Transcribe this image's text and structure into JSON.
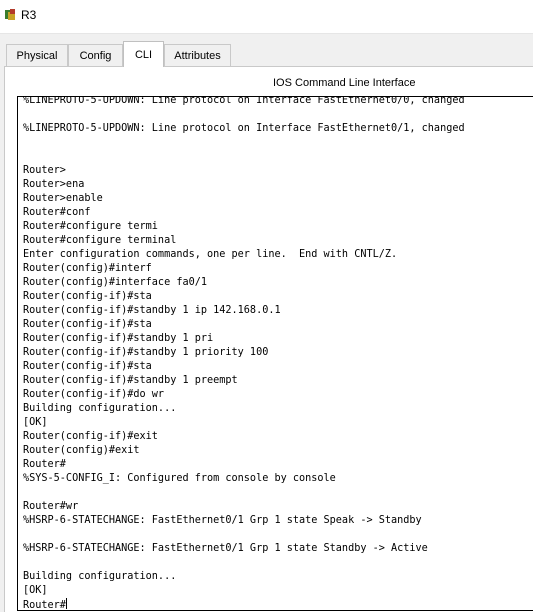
{
  "window": {
    "title": "R3"
  },
  "tabs": [
    {
      "label": "Physical",
      "active": false
    },
    {
      "label": "Config",
      "active": false
    },
    {
      "label": "CLI",
      "active": true
    },
    {
      "label": "Attributes",
      "active": false
    }
  ],
  "cli": {
    "heading": "IOS Command Line Interface",
    "lines": [
      "%LINEPROTO-5-UPDOWN: Line protocol on Interface FastEthernet0/0, changed",
      "",
      "%LINEPROTO-5-UPDOWN: Line protocol on Interface FastEthernet0/1, changed",
      "",
      "",
      "Router>",
      "Router>ena",
      "Router>enable",
      "Router#conf",
      "Router#configure termi",
      "Router#configure terminal",
      "Enter configuration commands, one per line.  End with CNTL/Z.",
      "Router(config)#interf",
      "Router(config)#interface fa0/1",
      "Router(config-if)#sta",
      "Router(config-if)#standby 1 ip 142.168.0.1",
      "Router(config-if)#sta",
      "Router(config-if)#standby 1 pri",
      "Router(config-if)#standby 1 priority 100",
      "Router(config-if)#sta",
      "Router(config-if)#standby 1 preempt",
      "Router(config-if)#do wr",
      "Building configuration...",
      "[OK]",
      "Router(config-if)#exit",
      "Router(config)#exit",
      "Router#",
      "%SYS-5-CONFIG_I: Configured from console by console",
      "",
      "Router#wr",
      "%HSRP-6-STATECHANGE: FastEthernet0/1 Grp 1 state Speak -> Standby",
      "",
      "%HSRP-6-STATECHANGE: FastEthernet0/1 Grp 1 state Standby -> Active",
      "",
      "Building configuration...",
      "[OK]",
      "Router#"
    ]
  }
}
